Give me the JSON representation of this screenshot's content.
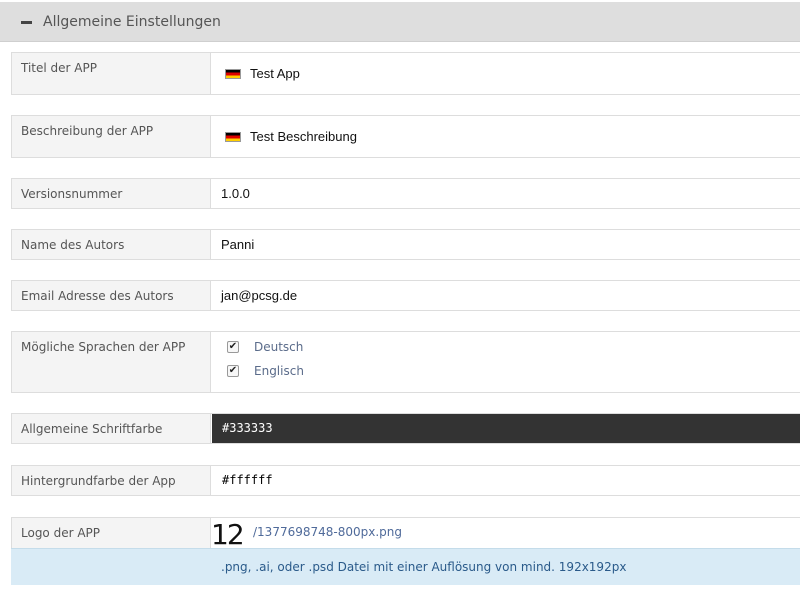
{
  "section": {
    "title": "Allgemeine Einstellungen",
    "collapse_icon": "minus-icon"
  },
  "fields": {
    "title": {
      "label": "Titel der APP",
      "value": "Test App",
      "flag_icon": "german-flag-icon"
    },
    "description": {
      "label": "Beschreibung der APP",
      "value": "Test Beschreibung",
      "flag_icon": "german-flag-icon"
    },
    "version": {
      "label": "Versionsnummer",
      "value": "1.0.0"
    },
    "author": {
      "label": "Name des Autors",
      "value": "Panni"
    },
    "email": {
      "label": "Email Adresse des Autors",
      "value": "jan@pcsg.de"
    },
    "languages": {
      "label": "Mögliche Sprachen der APP",
      "options": [
        {
          "label": "Deutsch",
          "checked": true
        },
        {
          "label": "Englisch",
          "checked": true
        }
      ]
    },
    "font_color": {
      "label": "Allgemeine Schriftfarbe",
      "value": "#333333",
      "swatch_color": "#333333",
      "text_color": "#ffffff"
    },
    "background_color": {
      "label": "Hintergrundfarbe der App",
      "value": "#ffffff",
      "swatch_color": "#ffffff",
      "text_color": "#000000"
    },
    "logo": {
      "label": "Logo der APP",
      "thumbnail_text": "12",
      "file_path": "/1377698748-800px.png",
      "hint": ".png, .ai, oder .psd Datei mit einer Auflösung von mind. 192x192px"
    }
  },
  "colors": {
    "header_bg": "#dedede",
    "label_bg": "#f4f4f4",
    "hint_bg": "#d9ebf6",
    "link": "#4f6a9a"
  }
}
